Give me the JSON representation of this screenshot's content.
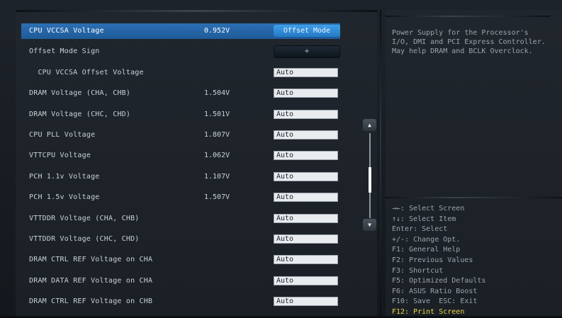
{
  "items": [
    {
      "label": "CPU VCCSA Voltage",
      "value": "0.952V",
      "control": "Offset Mode",
      "type": "mode",
      "selected": true
    },
    {
      "label": "Offset Mode Sign",
      "value": "",
      "control": "+",
      "type": "sign"
    },
    {
      "label": "  CPU VCCSA Offset Voltage",
      "value": "",
      "control": "Auto",
      "type": "field"
    },
    {
      "label": "DRAM Voltage (CHA, CHB)",
      "value": "1.504V",
      "control": "Auto",
      "type": "field"
    },
    {
      "label": "DRAM Voltage (CHC, CHD)",
      "value": "1.501V",
      "control": "Auto",
      "type": "field"
    },
    {
      "label": "CPU PLL Voltage",
      "value": "1.807V",
      "control": "Auto",
      "type": "field"
    },
    {
      "label": "VTTCPU Voltage",
      "value": "1.062V",
      "control": "Auto",
      "type": "field"
    },
    {
      "label": "PCH 1.1v Voltage",
      "value": "1.107V",
      "control": "Auto",
      "type": "field"
    },
    {
      "label": "PCH 1.5v Voltage",
      "value": "1.507V",
      "control": "Auto",
      "type": "field"
    },
    {
      "label": "VTTDDR Voltage (CHA, CHB)",
      "value": "",
      "control": "Auto",
      "type": "field"
    },
    {
      "label": "VTTDDR Voltage (CHC, CHD)",
      "value": "",
      "control": "Auto",
      "type": "field"
    },
    {
      "label": "DRAM CTRL REF Voltage on CHA",
      "value": "",
      "control": "Auto",
      "type": "field"
    },
    {
      "label": "DRAM DATA REF Voltage on CHA",
      "value": "",
      "control": "Auto",
      "type": "field"
    },
    {
      "label": "DRAM CTRL REF Voltage on CHB",
      "value": "",
      "control": "Auto",
      "type": "field"
    }
  ],
  "help": {
    "lines": [
      "Power Supply for the Processor's",
      "I/O, DMI and PCI Express Controller.",
      "May help DRAM and BCLK Overclock."
    ]
  },
  "keys": [
    {
      "text": "→←: Select Screen"
    },
    {
      "text": "↑↓: Select Item"
    },
    {
      "text": "Enter: Select"
    },
    {
      "text": "+/-: Change Opt."
    },
    {
      "text": "F1: General Help"
    },
    {
      "text": "F2: Previous Values"
    },
    {
      "text": "F3: Shortcut"
    },
    {
      "text": "F5: Optimized Defaults"
    },
    {
      "text": "F6: ASUS Ratio Boost"
    },
    {
      "text": "F10: Save  ESC: Exit"
    },
    {
      "text": "F12: Print Screen",
      "highlight": true
    }
  ],
  "scrollbar": {
    "up_icon": "triangle-up-icon",
    "down_icon": "triangle-down-icon"
  },
  "colors": {
    "selected_row": "#2c6fb4",
    "mode_button": "#3fa0e8",
    "highlight_key": "#e8d64a"
  }
}
